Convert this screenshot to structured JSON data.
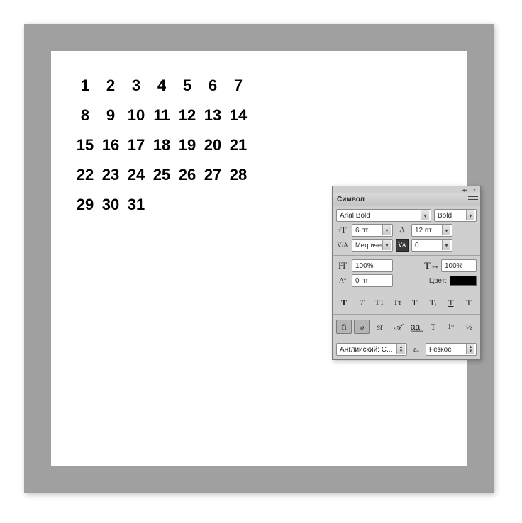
{
  "calendar": {
    "rows": [
      [
        "1",
        "2",
        "3",
        "4",
        "5",
        "6",
        "7"
      ],
      [
        "8",
        "9",
        "10",
        "11",
        "12",
        "13",
        "14"
      ],
      [
        "15",
        "16",
        "17",
        "18",
        "19",
        "20",
        "21"
      ],
      [
        "22",
        "23",
        "24",
        "25",
        "26",
        "27",
        "28"
      ],
      [
        "29",
        "30",
        "31"
      ]
    ]
  },
  "panel": {
    "title": "Символ",
    "font_family": "Arial Bold",
    "font_style": "Bold",
    "size": "6 пт",
    "leading": "12 пт",
    "kerning": "Метрическ.",
    "tracking": "0",
    "vscale": "100%",
    "hscale": "100%",
    "baseline": "0 пт",
    "color_label": "Цвет:",
    "language": "Английский: С...",
    "anti_alias": "Резкое",
    "aa_icon": "aₐ",
    "style_labels": {
      "bold": "T",
      "italic": "T",
      "allcaps": "TT",
      "smallcaps": "Tᴛ",
      "superscript": "T",
      "subscript": "T",
      "underline": "T",
      "strike": "T"
    },
    "ot_labels": {
      "liga": "fi",
      "calt": "ℴ",
      "dlig": "st",
      "swsh": "𝒜",
      "salt": "a͟a͟",
      "titl": "T",
      "ordn": "1ˢᵗ",
      "frac": "½"
    }
  }
}
